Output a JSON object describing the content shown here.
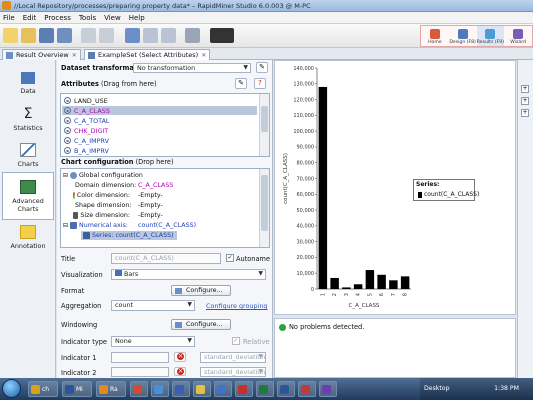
{
  "window": {
    "title": "//Local Repository/processes/preparing property data* – RapidMiner Studio 6.0.003 @ M-PC"
  },
  "menu": [
    "File",
    "Edit",
    "Process",
    "Tools",
    "View",
    "Help"
  ],
  "perspectives": [
    {
      "label": "Home",
      "icon": "home-icon",
      "active": false
    },
    {
      "label": "Design (F8)",
      "icon": "design-icon",
      "active": false
    },
    {
      "label": "Results (F9)",
      "icon": "results-icon",
      "active": true
    },
    {
      "label": "Wizard",
      "icon": "wizard-icon",
      "active": false
    }
  ],
  "tabs": [
    {
      "label": "Result Overview",
      "active": false
    },
    {
      "label": "ExampleSet (Select Attributes)",
      "active": true
    }
  ],
  "sidenav": [
    {
      "label": "Data",
      "icon": "data-icon",
      "active": false
    },
    {
      "label": "Statistics",
      "icon": "sigma-icon",
      "active": false
    },
    {
      "label": "Charts",
      "icon": "chart-icon",
      "active": false
    },
    {
      "label": "Advanced Charts",
      "icon": "advanced-chart-icon",
      "active": true
    },
    {
      "label": "Annotation",
      "icon": "annotation-icon",
      "active": false
    }
  ],
  "panel": {
    "dataset_transformation_label": "Dataset transformation",
    "dataset_transformation_value": "No transformation",
    "attributes_label": "Attributes",
    "attributes_hint": "(Drag from here)",
    "attributes": [
      "LAND_USE",
      "C_A_CLASS",
      "C_A_TOTAL",
      "CHK_DIGIT",
      "C_A_IMPRV",
      "B_A_IMPRV"
    ],
    "selected_attribute": "C_A_CLASS",
    "chart_config_label": "Chart configuration",
    "chart_config_hint": "(Drop here)",
    "global_config": "Global configuration",
    "config_rows": [
      {
        "key": "Domain dimension:",
        "value": "C_A_CLASS",
        "color": "#b300b3"
      },
      {
        "key": "Color dimension:",
        "value": "-Empty-",
        "color": "#111111"
      },
      {
        "key": "Shape dimension:",
        "value": "-Empty-",
        "color": "#111111"
      },
      {
        "key": "Size dimension:",
        "value": "-Empty-",
        "color": "#111111"
      }
    ],
    "numerical_axis_key": "Numerical axis:",
    "numerical_axis_value": "count(C_A_CLASS)",
    "series_item": "Series: count(C_A_CLASS)",
    "title_label": "Title",
    "title_value": "count(C_A_CLASS)",
    "autoname_label": "Autoname",
    "visualization_label": "Visualization",
    "visualization_value": "Bars",
    "format_label": "Format",
    "aggregation_label": "Aggregation",
    "aggregation_value": "count",
    "configure_grouping": "Configure grouping",
    "windowing_label": "Windowing",
    "configure_btn": "Configure...",
    "indicator_type_label": "Indicator type",
    "indicator_type_value": "None",
    "relative_label": "Relative",
    "indicator1_label": "Indicator 1",
    "indicator2_label": "Indicator 2",
    "indicator_value": "standard_deviation"
  },
  "chart_data": {
    "type": "bar",
    "categories": [
      "1",
      "2",
      "3",
      "4",
      "5",
      "6",
      "7",
      "8"
    ],
    "values": [
      128000,
      7000,
      1000,
      3000,
      12000,
      9000,
      5500,
      8000
    ],
    "ylabel": "count(C_A_CLASS)",
    "xlabel": "C_A_CLASS",
    "ylim": [
      0,
      140000
    ],
    "yticks": [
      "0",
      "10,000",
      "20,000",
      "30,000",
      "40,000",
      "50,000",
      "60,000",
      "70,000",
      "80,000",
      "90,000",
      "100,000",
      "110,000",
      "120,000",
      "130,000",
      "140,000"
    ],
    "legend": {
      "title": "Series:",
      "entry": "count(C_A_CLASS)",
      "position": "right"
    },
    "bar_color": "#000000"
  },
  "status": {
    "message": "No problems detected."
  },
  "taskbar": {
    "desktop": "Desktop",
    "time": "1:38 PM",
    "items": [
      {
        "label": "ch",
        "color": "#d9a21b"
      },
      {
        "label": "Mi",
        "color": "#2b579a"
      },
      {
        "label": "Ra",
        "color": "#e38a1c"
      },
      {
        "label": "",
        "color": "#d44a2c"
      },
      {
        "label": "",
        "color": "#4a90d9"
      },
      {
        "label": "",
        "color": "#3b5fb0"
      },
      {
        "label": "",
        "color": "#e0c24a"
      },
      {
        "label": "",
        "color": "#3f73c9"
      },
      {
        "label": "",
        "color": "#c43030"
      },
      {
        "label": "",
        "color": "#1e7b3a"
      },
      {
        "label": "",
        "color": "#2b579a"
      },
      {
        "label": "",
        "color": "#c23b3b"
      },
      {
        "label": "",
        "color": "#6a3fb0"
      }
    ]
  }
}
